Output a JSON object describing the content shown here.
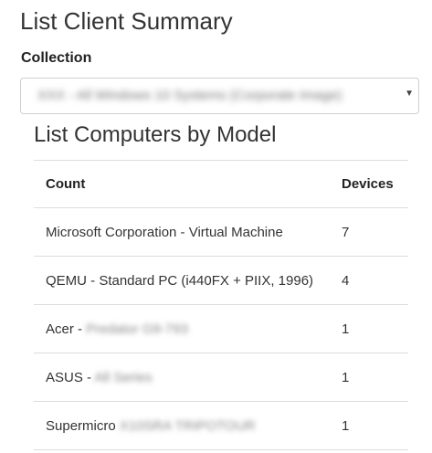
{
  "page": {
    "title": "List Client Summary"
  },
  "collection": {
    "label": "Collection",
    "selected_value": "XXX - All Windows 10 Systems (Corporate Image)"
  },
  "computers_by_model": {
    "title": "List Computers by Model",
    "columns": [
      "Count",
      "Devices"
    ],
    "rows": [
      {
        "manufacturer": "Microsoft Corporation - Virtual Machine",
        "model_hidden": "",
        "devices": "7"
      },
      {
        "manufacturer": "QEMU - Standard PC (i440FX + PIIX, 1996)",
        "model_hidden": "",
        "devices": "4"
      },
      {
        "manufacturer": "Acer - ",
        "model_hidden": "Predator G9-793",
        "devices": "1"
      },
      {
        "manufacturer": "ASUS - ",
        "model_hidden": "All Series",
        "devices": "1"
      },
      {
        "manufacturer": "Supermicro ",
        "model_hidden": "X10SRA TRIPOTOUR",
        "devices": "1"
      }
    ]
  }
}
